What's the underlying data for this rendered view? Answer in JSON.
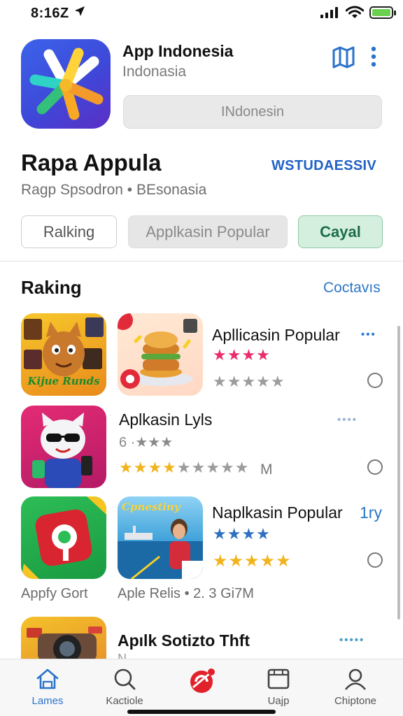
{
  "status": {
    "time": "8:16Z"
  },
  "header": {
    "app_name": "App Indonesia",
    "app_subtitle": "Indonasia",
    "get_button": "INdonesin"
  },
  "section_top": {
    "title": "Rapa Appula",
    "link": "WSTUDAESSIV",
    "meta": "Ragp Spsodron • BEsonasia"
  },
  "chips": [
    "Ralking",
    "Applkasin Popular",
    "Cayal"
  ],
  "ranking": {
    "title": "Raking",
    "link": "Coctavıs",
    "items": [
      {
        "title": "Apllicasin Popular",
        "stars_top": "★★★★",
        "stars_bottom": "★★★★★"
      },
      {
        "title": "Aplkasin Lyls",
        "sub": "6 ·★★★",
        "stars_bottom": "★★★★★★★★★",
        "suffix": "M"
      },
      {
        "title": "Naplkasin Popular",
        "badge": "1ry",
        "stars_top": "★★★★",
        "stars_bottom": "★★★★★",
        "caption_left": "Appfy Gort",
        "caption_right": "Aple Relis • 2. 3 Gi7M"
      },
      {
        "title": "Apılk Sotizto Thft",
        "sub": "N···"
      }
    ],
    "thumb1_text": "Kijue Runds",
    "thumb5_text": "Cpnestiny"
  },
  "tabs": [
    {
      "label": "Lames",
      "icon": "home-icon"
    },
    {
      "label": "Kactiole",
      "icon": "search-icon"
    },
    {
      "label": "",
      "icon": "brand-logo-icon"
    },
    {
      "label": "Uajp",
      "icon": "inbox-icon"
    },
    {
      "label": "Chiptone",
      "icon": "person-icon"
    }
  ],
  "colors": {
    "accent": "#2a73c9",
    "green_chip": "#d5efdf",
    "pink_star": "#ea2d6a",
    "gold_star": "#f2b41c"
  }
}
